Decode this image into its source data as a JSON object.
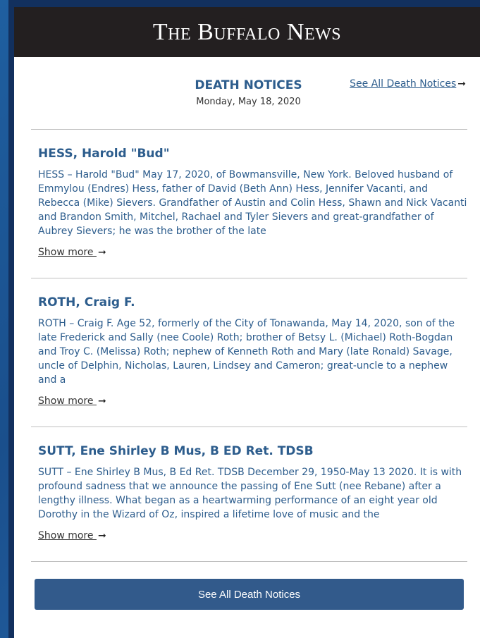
{
  "masthead": {
    "logo_text": "The Buffalo News"
  },
  "section": {
    "title": "DEATH NOTICES",
    "date": "Monday, May 18, 2020",
    "see_all_link": "See All Death Notices",
    "arrow": "➞"
  },
  "notices": [
    {
      "name": "HESS, Harold \"Bud\"",
      "body": "HESS – Harold \"Bud\" May 17, 2020, of Bowmansville, New York. Beloved husband of Emmylou (Endres) Hess, father of David (Beth Ann) Hess, Jennifer Vacanti, and Rebecca (Mike) Sievers. Grandfather of Austin and Colin Hess, Shawn and Nick Vacanti and Brandon Smith, Mitchel, Rachael and Tyler Sievers and great-grandfather of Aubrey Sievers; he was the brother of the late",
      "show_more": "Show more"
    },
    {
      "name": "ROTH, Craig F.",
      "body": "ROTH – Craig F. Age 52, formerly of the City of Tonawanda, May 14, 2020, son of the late Frederick and Sally (nee Coole) Roth; brother of Betsy L. (Michael) Roth-Bogdan and Troy C. (Melissa) Roth; nephew of Kenneth Roth and Mary (late Ronald) Savage, uncle of Delphin, Nicholas, Lauren, Lindsey and Cameron; great-uncle to a nephew and a",
      "show_more": "Show more"
    },
    {
      "name": "SUTT, Ene Shirley B Mus, B ED Ret. TDSB",
      "body": "SUTT – Ene Shirley B Mus, B Ed Ret. TDSB December 29, 1950-May 13 2020. It is with profound sadness that we announce the passing of Ene Sutt (nee Rebane) after a lengthy illness. What began as a heartwarming performance of an eight year old Dorothy in the Wizard of Oz, inspired a lifetime love of music and the",
      "show_more": "Show more"
    }
  ],
  "cta": {
    "label": "See All Death Notices"
  },
  "colors": {
    "brand_blue": "#2d5d8d",
    "button_blue": "#325a8b",
    "masthead": "#231f20"
  }
}
